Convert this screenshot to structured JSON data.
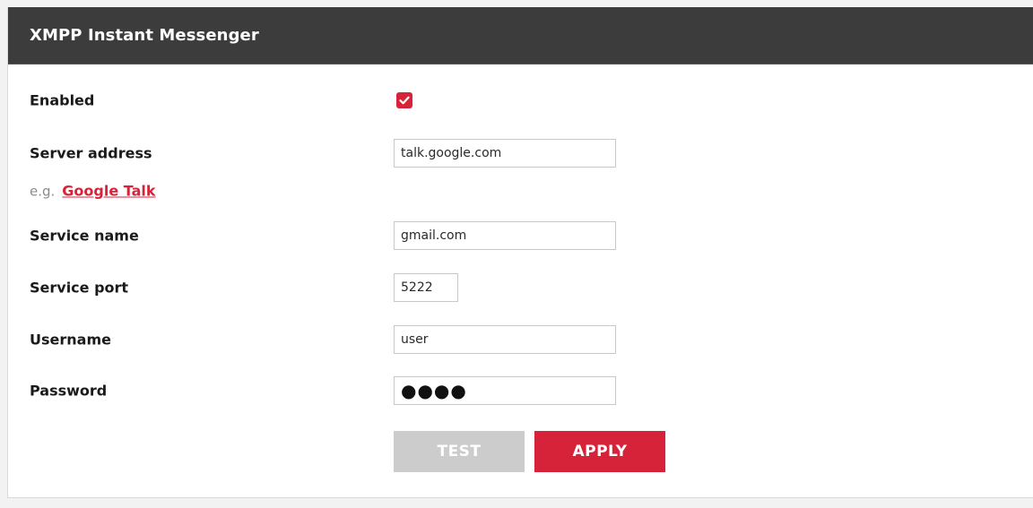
{
  "header": {
    "title": "XMPP Instant Messenger"
  },
  "form": {
    "enabled": {
      "label": "Enabled",
      "checked": true
    },
    "server_address": {
      "label": "Server address",
      "value": "talk.google.com"
    },
    "example": {
      "prefix": "e.g.",
      "link_text": "Google Talk"
    },
    "service_name": {
      "label": "Service name",
      "value": "gmail.com"
    },
    "service_port": {
      "label": "Service port",
      "value": "5222"
    },
    "username": {
      "label": "Username",
      "value": "user"
    },
    "password": {
      "label": "Password",
      "masked_value": "●●●●"
    }
  },
  "actions": {
    "test_label": "TEST",
    "apply_label": "APPLY"
  },
  "colors": {
    "accent": "#d6233a",
    "header_bg": "#3c3c3c",
    "disabled_button": "#cccccc"
  },
  "icons": {
    "checkbox": "checkmark-icon"
  }
}
